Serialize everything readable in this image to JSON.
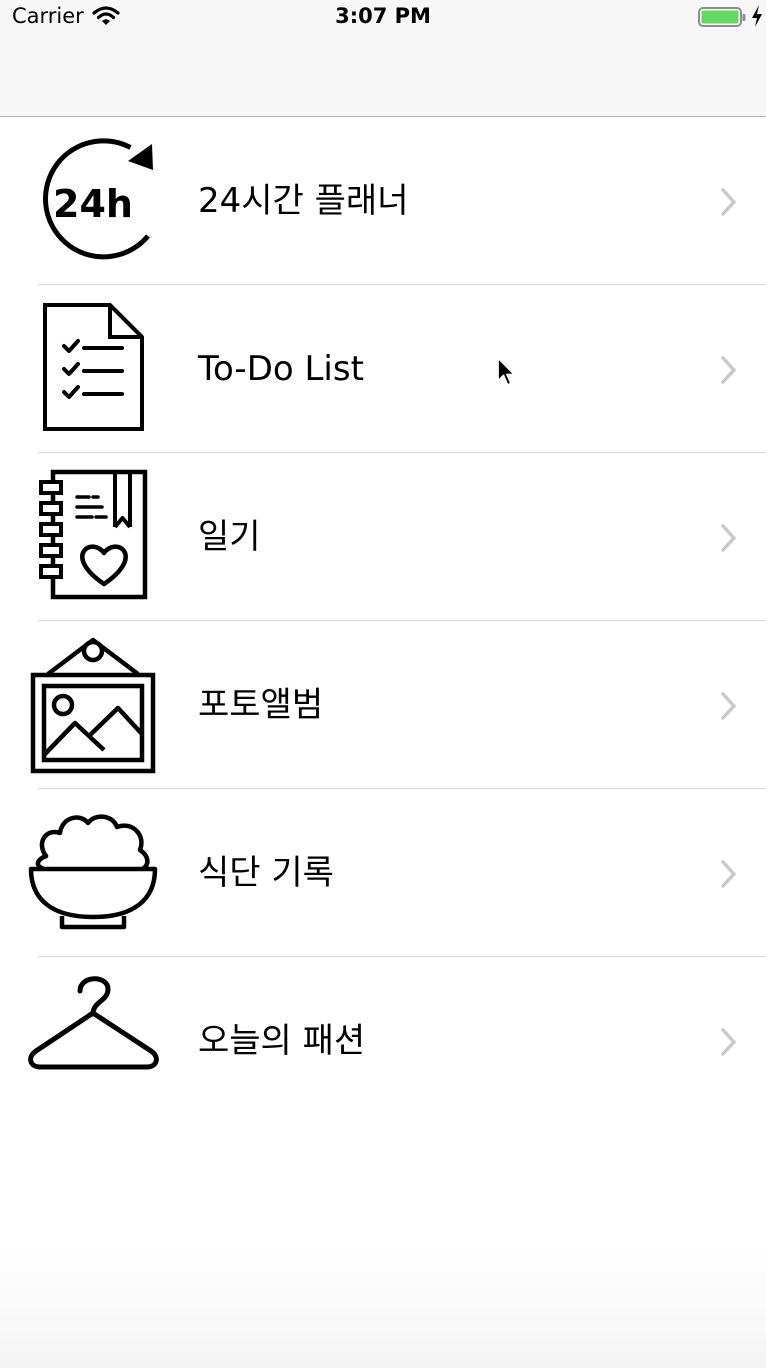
{
  "status_bar": {
    "carrier": "Carrier",
    "time": "3:07 PM",
    "battery_color": "#64d864"
  },
  "menu": {
    "items": [
      {
        "label": "24시간 플래너",
        "icon": "clock-24h-icon",
        "icon_text": "24h"
      },
      {
        "label": "To-Do List",
        "icon": "checklist-document-icon"
      },
      {
        "label": "일기",
        "icon": "diary-heart-icon"
      },
      {
        "label": "포토앨범",
        "icon": "framed-picture-icon"
      },
      {
        "label": "식단 기록",
        "icon": "rice-bowl-icon"
      },
      {
        "label": "오늘의 패션",
        "icon": "clothes-hanger-icon"
      }
    ]
  }
}
